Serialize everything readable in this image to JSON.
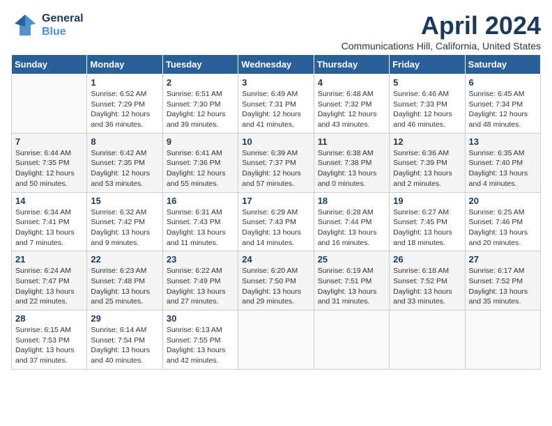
{
  "header": {
    "logo_line1": "General",
    "logo_line2": "Blue",
    "title": "April 2024",
    "location": "Communications Hill, California, United States"
  },
  "weekdays": [
    "Sunday",
    "Monday",
    "Tuesday",
    "Wednesday",
    "Thursday",
    "Friday",
    "Saturday"
  ],
  "weeks": [
    [
      {
        "day": "",
        "info": ""
      },
      {
        "day": "1",
        "info": "Sunrise: 6:52 AM\nSunset: 7:29 PM\nDaylight: 12 hours\nand 36 minutes."
      },
      {
        "day": "2",
        "info": "Sunrise: 6:51 AM\nSunset: 7:30 PM\nDaylight: 12 hours\nand 39 minutes."
      },
      {
        "day": "3",
        "info": "Sunrise: 6:49 AM\nSunset: 7:31 PM\nDaylight: 12 hours\nand 41 minutes."
      },
      {
        "day": "4",
        "info": "Sunrise: 6:48 AM\nSunset: 7:32 PM\nDaylight: 12 hours\nand 43 minutes."
      },
      {
        "day": "5",
        "info": "Sunrise: 6:46 AM\nSunset: 7:33 PM\nDaylight: 12 hours\nand 46 minutes."
      },
      {
        "day": "6",
        "info": "Sunrise: 6:45 AM\nSunset: 7:34 PM\nDaylight: 12 hours\nand 48 minutes."
      }
    ],
    [
      {
        "day": "7",
        "info": "Sunrise: 6:44 AM\nSunset: 7:35 PM\nDaylight: 12 hours\nand 50 minutes."
      },
      {
        "day": "8",
        "info": "Sunrise: 6:42 AM\nSunset: 7:35 PM\nDaylight: 12 hours\nand 53 minutes."
      },
      {
        "day": "9",
        "info": "Sunrise: 6:41 AM\nSunset: 7:36 PM\nDaylight: 12 hours\nand 55 minutes."
      },
      {
        "day": "10",
        "info": "Sunrise: 6:39 AM\nSunset: 7:37 PM\nDaylight: 12 hours\nand 57 minutes."
      },
      {
        "day": "11",
        "info": "Sunrise: 6:38 AM\nSunset: 7:38 PM\nDaylight: 13 hours\nand 0 minutes."
      },
      {
        "day": "12",
        "info": "Sunrise: 6:36 AM\nSunset: 7:39 PM\nDaylight: 13 hours\nand 2 minutes."
      },
      {
        "day": "13",
        "info": "Sunrise: 6:35 AM\nSunset: 7:40 PM\nDaylight: 13 hours\nand 4 minutes."
      }
    ],
    [
      {
        "day": "14",
        "info": "Sunrise: 6:34 AM\nSunset: 7:41 PM\nDaylight: 13 hours\nand 7 minutes."
      },
      {
        "day": "15",
        "info": "Sunrise: 6:32 AM\nSunset: 7:42 PM\nDaylight: 13 hours\nand 9 minutes."
      },
      {
        "day": "16",
        "info": "Sunrise: 6:31 AM\nSunset: 7:43 PM\nDaylight: 13 hours\nand 11 minutes."
      },
      {
        "day": "17",
        "info": "Sunrise: 6:29 AM\nSunset: 7:43 PM\nDaylight: 13 hours\nand 14 minutes."
      },
      {
        "day": "18",
        "info": "Sunrise: 6:28 AM\nSunset: 7:44 PM\nDaylight: 13 hours\nand 16 minutes."
      },
      {
        "day": "19",
        "info": "Sunrise: 6:27 AM\nSunset: 7:45 PM\nDaylight: 13 hours\nand 18 minutes."
      },
      {
        "day": "20",
        "info": "Sunrise: 6:25 AM\nSunset: 7:46 PM\nDaylight: 13 hours\nand 20 minutes."
      }
    ],
    [
      {
        "day": "21",
        "info": "Sunrise: 6:24 AM\nSunset: 7:47 PM\nDaylight: 13 hours\nand 22 minutes."
      },
      {
        "day": "22",
        "info": "Sunrise: 6:23 AM\nSunset: 7:48 PM\nDaylight: 13 hours\nand 25 minutes."
      },
      {
        "day": "23",
        "info": "Sunrise: 6:22 AM\nSunset: 7:49 PM\nDaylight: 13 hours\nand 27 minutes."
      },
      {
        "day": "24",
        "info": "Sunrise: 6:20 AM\nSunset: 7:50 PM\nDaylight: 13 hours\nand 29 minutes."
      },
      {
        "day": "25",
        "info": "Sunrise: 6:19 AM\nSunset: 7:51 PM\nDaylight: 13 hours\nand 31 minutes."
      },
      {
        "day": "26",
        "info": "Sunrise: 6:18 AM\nSunset: 7:52 PM\nDaylight: 13 hours\nand 33 minutes."
      },
      {
        "day": "27",
        "info": "Sunrise: 6:17 AM\nSunset: 7:52 PM\nDaylight: 13 hours\nand 35 minutes."
      }
    ],
    [
      {
        "day": "28",
        "info": "Sunrise: 6:15 AM\nSunset: 7:53 PM\nDaylight: 13 hours\nand 37 minutes."
      },
      {
        "day": "29",
        "info": "Sunrise: 6:14 AM\nSunset: 7:54 PM\nDaylight: 13 hours\nand 40 minutes."
      },
      {
        "day": "30",
        "info": "Sunrise: 6:13 AM\nSunset: 7:55 PM\nDaylight: 13 hours\nand 42 minutes."
      },
      {
        "day": "",
        "info": ""
      },
      {
        "day": "",
        "info": ""
      },
      {
        "day": "",
        "info": ""
      },
      {
        "day": "",
        "info": ""
      }
    ]
  ]
}
